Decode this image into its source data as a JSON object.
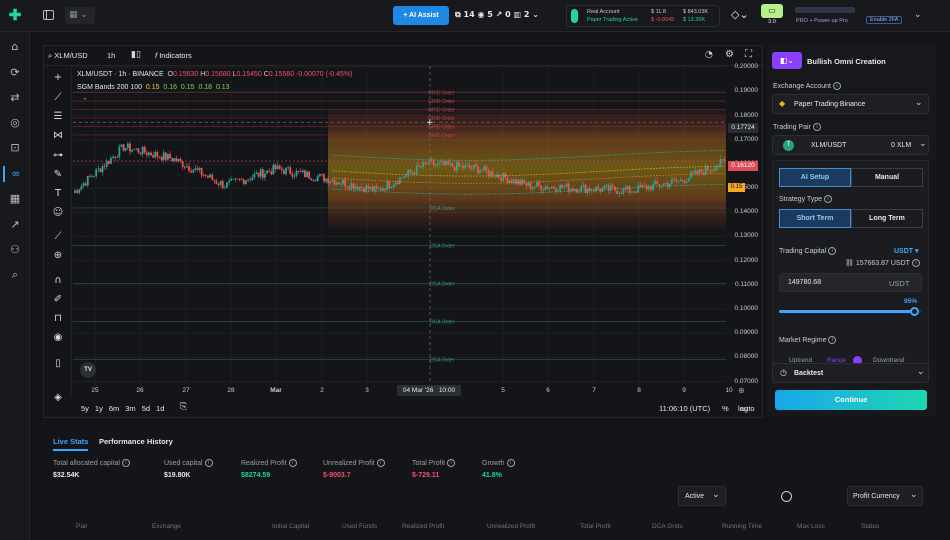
{
  "topbar": {
    "ai_assist": "AI Assist",
    "stat1": "14",
    "stat2": "5",
    "stat3": "0",
    "stat4": "2",
    "account_label": "Real Account",
    "account_sub": "Paper Trading Active",
    "val1": "11.8",
    "val1b": "-0.8045",
    "val2": "843.03K",
    "val2b": "13.26K",
    "version": "3.0",
    "pro_label": "PRO + Power-up Pro",
    "enable_2fa": "Enable 2FA"
  },
  "chart": {
    "symbol": "XLM/USD",
    "interval": "1h",
    "indicators": "Indicators",
    "title": "XLM/USDT · 1h · BINANCE",
    "o": "O",
    "ov": "0.15630",
    "h": "H",
    "hv": "0.15680",
    "l": "L",
    "lv": "0.15450",
    "c": "C",
    "cv": "0.15560",
    "chg": "-0.00070 (-0.45%)",
    "bands": "SGM Bands 200 100",
    "b1": "0.15",
    "b2": "0.16",
    "b3": "0.15",
    "b4": "0.18",
    "b5": "0.13",
    "crosshair_price": "0.17724",
    "last_price": "0.16120",
    "band_label": "0.15",
    "crosshair_date": "04 Mar '26   10:00",
    "time": "11:06:10 (UTC)",
    "pct": "%",
    "log": "log",
    "auto": "auto",
    "ranges": [
      "5y",
      "1y",
      "6m",
      "3m",
      "5d",
      "1d"
    ],
    "grid_order": "GRID Order",
    "dca_order": "DCA Order",
    "sell_order": "Sell Order",
    "logo": "TV",
    "yticks": [
      "0.20000",
      "0.19000",
      "0.18000",
      "0.17000",
      "0.16000",
      "0.15000",
      "0.14000",
      "0.13000",
      "0.12000",
      "0.11000",
      "0.10000",
      "0.09000",
      "0.08000",
      "0.07000"
    ],
    "xticks": [
      "25",
      "26",
      "27",
      "28",
      "Mar",
      "2",
      "3",
      "5",
      "6",
      "7",
      "8",
      "9",
      "10"
    ]
  },
  "chart_data": {
    "type": "line",
    "title": "XLM/USDT · 1h · BINANCE",
    "ylim": [
      0.07,
      0.2
    ],
    "x": [
      "25",
      "26",
      "27",
      "28",
      "Mar",
      "2",
      "3",
      "4",
      "5",
      "6",
      "7",
      "8",
      "9",
      "10"
    ],
    "series": [
      {
        "name": "XLM/USDT",
        "values": [
          0.148,
          0.167,
          0.162,
          0.151,
          0.158,
          0.154,
          0.149,
          0.16,
          0.158,
          0.151,
          0.15,
          0.149,
          0.153,
          0.162
        ]
      }
    ]
  },
  "right": {
    "strategy": "Bullish Omni Creation",
    "exchange_label": "Exchange Account",
    "exchange": "Paper Trading Binance",
    "pair_label": "Trading Pair",
    "pair": "XLM/USDT",
    "pair_balance": "0 XLM",
    "ai_setup": "AI Setup",
    "manual": "Manual",
    "strategy_type": "Strategy Type",
    "short_term": "Short Term",
    "long_term": "Long Term",
    "capital_label": "Trading Capital",
    "currency": "USDT",
    "available": "157663.87 USDT",
    "capital_value": "149780.68",
    "capital_unit": "USDT",
    "slider_pct": "95%",
    "slider_level": 0.95,
    "regime_label": "Market Regime",
    "regime_opts": [
      "Uptrend",
      "Range",
      "Downtrend"
    ],
    "backtest": "Backtest",
    "continue": "Continue"
  },
  "stats": {
    "tab_live": "Live Stats",
    "tab_history": "Performance History",
    "items": [
      {
        "label": "Total allocated capital",
        "value": "$32.54K"
      },
      {
        "label": "Used capital",
        "value": "$19.80K"
      },
      {
        "label": "Realized Profit",
        "value": "$8274.59"
      },
      {
        "label": "Unrealized Profit",
        "value": "$-9003.7"
      },
      {
        "label": "Total Profit",
        "value": "$-729.11"
      },
      {
        "label": "Growth",
        "value": "41.8%"
      }
    ],
    "filter": "Active",
    "profit_currency": "Profit Currency",
    "columns": [
      "Pair",
      "Exchange",
      "Initial Capital",
      "Used Funds",
      "Realized Profit",
      "Unrealized Profit",
      "Total Profit",
      "DCA Grids",
      "Running Time",
      "Max Loss",
      "Status"
    ]
  }
}
